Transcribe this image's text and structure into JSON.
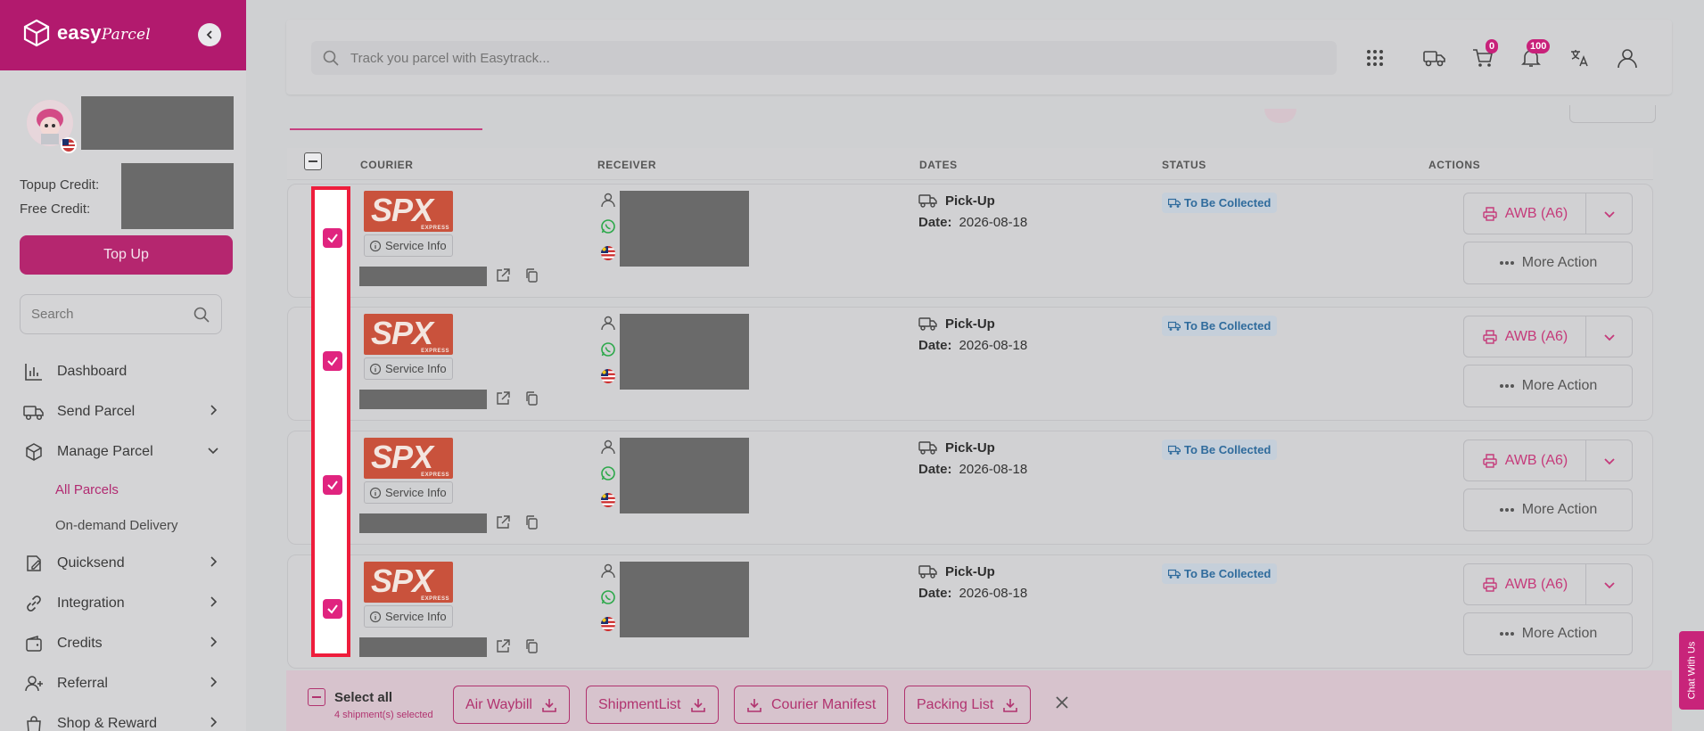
{
  "brand": {
    "name": "easy",
    "name_script": "Parcel"
  },
  "sidebar": {
    "topup_label": "Topup Credit:",
    "free_label": "Free Credit:",
    "topup_button": "Top Up",
    "search_placeholder": "Search",
    "nav": [
      {
        "label": "Dashboard",
        "icon": "chart-icon"
      },
      {
        "label": "Send Parcel",
        "icon": "truck-icon"
      },
      {
        "label": "Manage Parcel",
        "icon": "box-icon"
      },
      {
        "label": "Quicksend",
        "icon": "edit-icon"
      },
      {
        "label": "Integration",
        "icon": "link-icon"
      },
      {
        "label": "Credits",
        "icon": "wallet-icon"
      },
      {
        "label": "Referral",
        "icon": "user-plus-icon"
      },
      {
        "label": "Shop & Reward",
        "icon": "bag-icon"
      }
    ],
    "sub_items": [
      "All Parcels",
      "On-demand Delivery"
    ]
  },
  "header": {
    "search_placeholder": "Track you parcel with Easytrack...",
    "cart_count": "0",
    "notif_count": "100"
  },
  "table": {
    "columns": [
      "COURIER",
      "RECEIVER",
      "DATES",
      "STATUS",
      "ACTIONS"
    ],
    "rows": [
      {
        "courier": "SPX",
        "courier_sub": "EXPRESS",
        "service_info": "Service Info",
        "date_type": "Pick-Up",
        "date_label": "Date:",
        "date": "2026-08-18",
        "status": "To Be Collected",
        "awb": "AWB (A6)",
        "more": "More Action",
        "checked": true
      },
      {
        "courier": "SPX",
        "courier_sub": "EXPRESS",
        "service_info": "Service Info",
        "date_type": "Pick-Up",
        "date_label": "Date:",
        "date": "2026-08-18",
        "status": "To Be Collected",
        "awb": "AWB (A6)",
        "more": "More Action",
        "checked": true
      },
      {
        "courier": "SPX",
        "courier_sub": "EXPRESS",
        "service_info": "Service Info",
        "date_type": "Pick-Up",
        "date_label": "Date:",
        "date": "2026-08-18",
        "status": "To Be Collected",
        "awb": "AWB (A6)",
        "more": "More Action",
        "checked": true
      },
      {
        "courier": "SPX",
        "courier_sub": "EXPRESS",
        "service_info": "Service Info",
        "date_type": "Pick-Up",
        "date_label": "Date:",
        "date": "2026-08-18",
        "status": "To Be Collected",
        "awb": "AWB (A6)",
        "more": "More Action",
        "checked": true
      }
    ]
  },
  "bulk_bar": {
    "select_all": "Select all",
    "selected_count": "4 shipment(s) selected",
    "buttons": [
      "Air Waybill",
      "ShipmentList",
      "Courier Manifest",
      "Packing List"
    ]
  },
  "chat_label": "Chat With Us",
  "colors": {
    "brand": "#b21a6e",
    "accent": "#d72a84",
    "highlight": "#ee1d3c",
    "status": "#2f6b9c"
  }
}
